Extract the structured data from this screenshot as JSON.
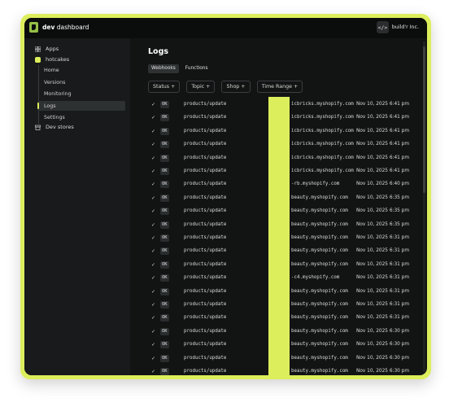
{
  "topbar": {
    "brand_bold": "dev",
    "brand_rest": " dashboard",
    "org_icon": "</>",
    "org_name": "build'r Inc."
  },
  "sidebar": {
    "apps": "Apps",
    "app_name": "hotcakes",
    "sub": [
      "Home",
      "Versions",
      "Monitoring",
      "Logs",
      "Settings"
    ],
    "active_sub": "Logs",
    "dev_stores": "Dev stores"
  },
  "main": {
    "title": "Logs",
    "tabs": [
      "Webhooks",
      "Functions"
    ],
    "active_tab": "Webhooks",
    "filters": [
      "Status +",
      "Topic +",
      "Shop +",
      "Time Range +"
    ]
  },
  "logs": [
    {
      "status": "OK",
      "topic": "products/update",
      "shop": "icbricks.myshopify.com",
      "time": "Nov 10, 2025 6:41 pm"
    },
    {
      "status": "OK",
      "topic": "products/update",
      "shop": "icbricks.myshopify.com",
      "time": "Nov 10, 2025 6:41 pm"
    },
    {
      "status": "OK",
      "topic": "products/update",
      "shop": "icbricks.myshopify.com",
      "time": "Nov 10, 2025 6:41 pm"
    },
    {
      "status": "OK",
      "topic": "products/update",
      "shop": "icbricks.myshopify.com",
      "time": "Nov 10, 2025 6:41 pm"
    },
    {
      "status": "OK",
      "topic": "products/update",
      "shop": "icbricks.myshopify.com",
      "time": "Nov 10, 2025 6:41 pm"
    },
    {
      "status": "OK",
      "topic": "products/update",
      "shop": "icbricks.myshopify.com",
      "time": "Nov 10, 2025 6:41 pm"
    },
    {
      "status": "OK",
      "topic": "products/update",
      "shop": "-rb.myshopify.com",
      "time": "Nov 10, 2025 6:40 pm"
    },
    {
      "status": "OK",
      "topic": "products/update",
      "shop": "beauty.myshopify.com",
      "time": "Nov 10, 2025 6:35 pm"
    },
    {
      "status": "OK",
      "topic": "products/update",
      "shop": "beauty.myshopify.com",
      "time": "Nov 10, 2025 6:35 pm"
    },
    {
      "status": "OK",
      "topic": "products/update",
      "shop": "beauty.myshopify.com",
      "time": "Nov 10, 2025 6:35 pm"
    },
    {
      "status": "OK",
      "topic": "products/update",
      "shop": "beauty.myshopify.com",
      "time": "Nov 10, 2025 6:31 pm"
    },
    {
      "status": "OK",
      "topic": "products/update",
      "shop": "beauty.myshopify.com",
      "time": "Nov 10, 2025 6:31 pm"
    },
    {
      "status": "OK",
      "topic": "products/update",
      "shop": "beauty.myshopify.com",
      "time": "Nov 10, 2025 6:31 pm"
    },
    {
      "status": "OK",
      "topic": "products/update",
      "shop": "-c4.myshopify.com",
      "time": "Nov 10, 2025 6:31 pm"
    },
    {
      "status": "OK",
      "topic": "products/update",
      "shop": "beauty.myshopify.com",
      "time": "Nov 10, 2025 6:31 pm"
    },
    {
      "status": "OK",
      "topic": "products/update",
      "shop": "beauty.myshopify.com",
      "time": "Nov 10, 2025 6:31 pm"
    },
    {
      "status": "OK",
      "topic": "products/update",
      "shop": "beauty.myshopify.com",
      "time": "Nov 10, 2025 6:31 pm"
    },
    {
      "status": "OK",
      "topic": "products/update",
      "shop": "beauty.myshopify.com",
      "time": "Nov 10, 2025 6:30 pm"
    },
    {
      "status": "OK",
      "topic": "products/update",
      "shop": "beauty.myshopify.com",
      "time": "Nov 10, 2025 6:30 pm"
    },
    {
      "status": "OK",
      "topic": "products/update",
      "shop": "beauty.myshopify.com",
      "time": "Nov 10, 2025 6:30 pm"
    },
    {
      "status": "OK",
      "topic": "products/update",
      "shop": "beauty.myshopify.com",
      "time": "Nov 10, 2025 6:30 pm"
    }
  ],
  "icons": {
    "apps": "grid-icon",
    "app": "app-icon",
    "dev_stores": "store-icon",
    "check": "checkmark-icon"
  },
  "colors": {
    "accent": "#dcee5c",
    "background": "#121414",
    "sidebar": "#181a1b",
    "brand_logo": "#95bf47"
  }
}
